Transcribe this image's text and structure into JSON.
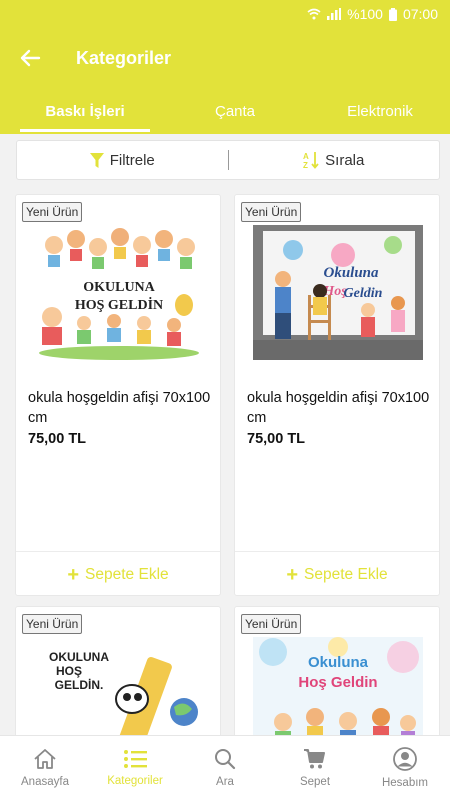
{
  "status": {
    "battery": "%100",
    "time": "07:00"
  },
  "header": {
    "title": "Kategoriler"
  },
  "tabs": [
    {
      "label": "Baskı İşleri",
      "active": true
    },
    {
      "label": "Çanta",
      "active": false
    },
    {
      "label": "Elektronik",
      "active": false
    }
  ],
  "filterbar": {
    "filter_label": "Filtrele",
    "sort_label": "Sırala"
  },
  "products": [
    {
      "badge": "Yeni Ürün",
      "name": "okula hoşgeldin afişi 70x100 cm",
      "price": "75,00 TL",
      "add_label": "Sepete Ekle",
      "image_text": [
        "OKULUNA",
        "HOŞ GELDİN"
      ]
    },
    {
      "badge": "Yeni Ürün",
      "name": "okula hoşgeldin afişi 70x100 cm",
      "price": "75,00 TL",
      "add_label": "Sepete Ekle",
      "image_text": [
        "Okuluna",
        "Hoş",
        "Geldin"
      ]
    },
    {
      "badge": "Yeni Ürün",
      "image_text": [
        "OKULUNA",
        "HOŞ",
        "GELDİN."
      ]
    },
    {
      "badge": "Yeni Ürün",
      "image_text": [
        "Okuluna",
        "Hoş Geldin"
      ]
    }
  ],
  "bottom_nav": [
    {
      "label": "Anasayfa",
      "icon": "home-icon",
      "active": false
    },
    {
      "label": "Kategoriler",
      "icon": "list-icon",
      "active": true
    },
    {
      "label": "Ara",
      "icon": "search-icon",
      "active": false
    },
    {
      "label": "Sepet",
      "icon": "cart-icon",
      "active": false
    },
    {
      "label": "Hesabım",
      "icon": "account-icon",
      "active": false
    }
  ],
  "colors": {
    "accent": "#e2e23a",
    "text": "#111111",
    "muted": "#888888"
  }
}
